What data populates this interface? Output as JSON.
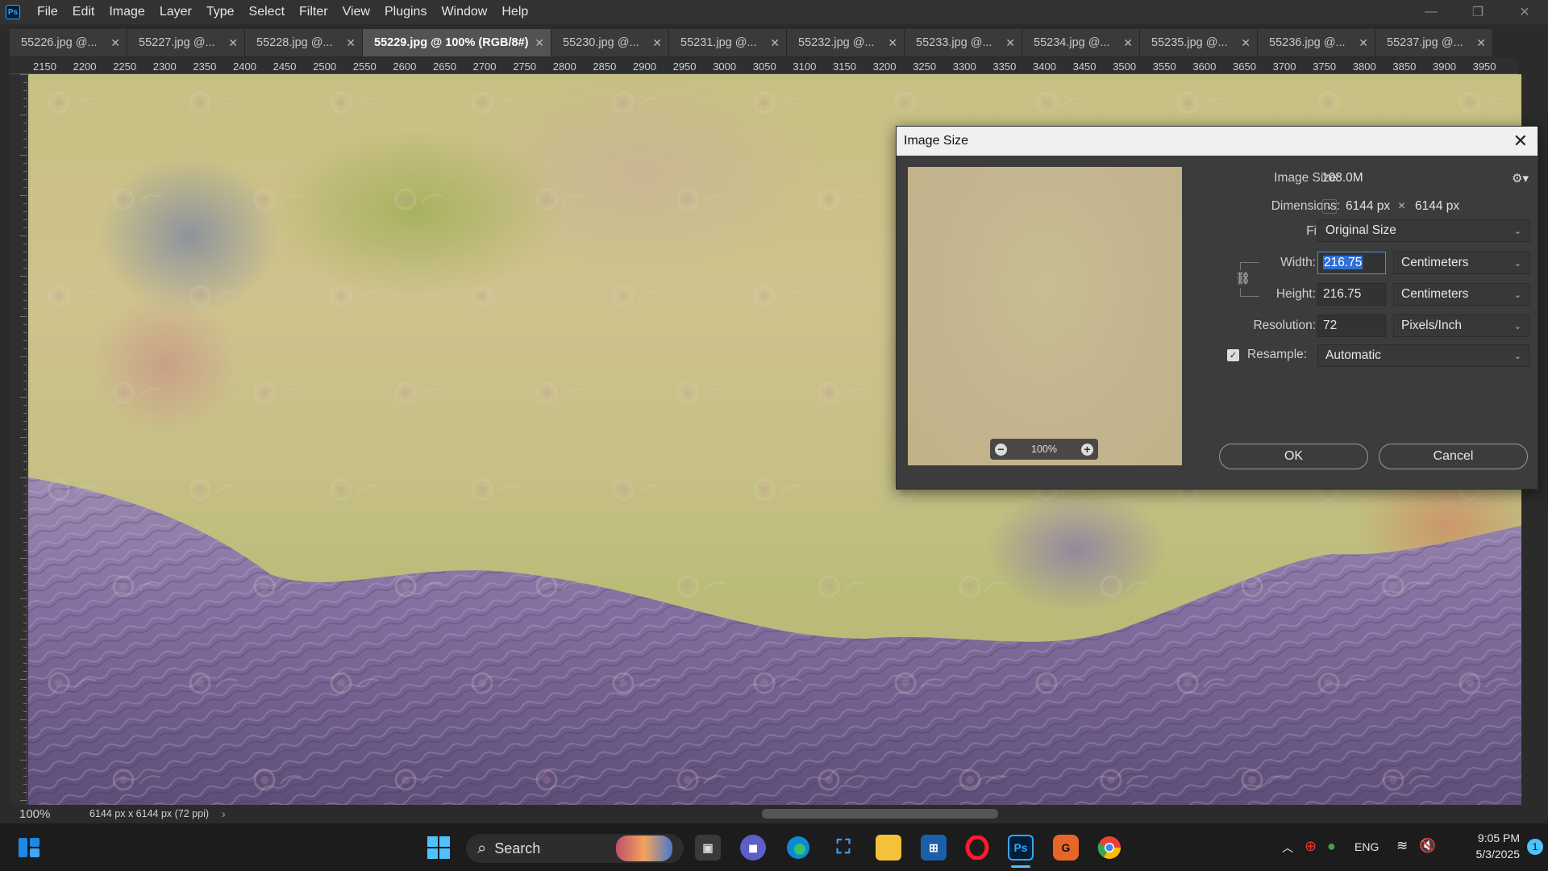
{
  "menubar": {
    "app_icon": "Ps",
    "items": [
      "File",
      "Edit",
      "Image",
      "Layer",
      "Type",
      "Select",
      "Filter",
      "View",
      "Plugins",
      "Window",
      "Help"
    ]
  },
  "tabs": [
    {
      "label": "55226.jpg @...",
      "active": false
    },
    {
      "label": "55227.jpg @...",
      "active": false
    },
    {
      "label": "55228.jpg @...",
      "active": false
    },
    {
      "label": "55229.jpg @ 100% (RGB/8#)",
      "active": true
    },
    {
      "label": "55230.jpg @...",
      "active": false
    },
    {
      "label": "55231.jpg @...",
      "active": false
    },
    {
      "label": "55232.jpg @...",
      "active": false
    },
    {
      "label": "55233.jpg @...",
      "active": false
    },
    {
      "label": "55234.jpg @...",
      "active": false
    },
    {
      "label": "55235.jpg @...",
      "active": false
    },
    {
      "label": "55236.jpg @...",
      "active": false
    },
    {
      "label": "55237.jpg @...",
      "active": false
    }
  ],
  "ruler": {
    "h_ticks": [
      "2150",
      "2200",
      "2250",
      "2300",
      "2350",
      "2400",
      "2450",
      "2500",
      "2550",
      "2600",
      "2650",
      "2700",
      "2750",
      "2800",
      "2850",
      "2900",
      "2950",
      "3000",
      "3050",
      "3100",
      "3150",
      "3200",
      "3250",
      "3300",
      "3350",
      "3400",
      "3450",
      "3500",
      "3550",
      "3600",
      "3650",
      "3700",
      "3750",
      "3800",
      "3850",
      "3900",
      "3950"
    ]
  },
  "status": {
    "zoom": "100%",
    "doc_info": "6144 px x 6144 px (72 ppi)",
    "arrow": "›"
  },
  "dialog": {
    "title": "Image Size",
    "image_size_label": "Image Size:",
    "image_size_value": "108.0M",
    "dimensions_label": "Dimensions:",
    "dim_w": "6144 px",
    "dim_x": "×",
    "dim_h": "6144 px",
    "fit_label": "Fit T...",
    "fit_value": "Original Size",
    "width_label": "Width:",
    "width_value": "216.75",
    "width_unit": "Centimeters",
    "height_label": "Height:",
    "height_value": "216.75",
    "height_unit": "Centimeters",
    "resolution_label": "Resolution:",
    "resolution_value": "72",
    "resolution_unit": "Pixels/Inch",
    "resample_label": "Resample:",
    "resample_checked": true,
    "resample_value": "Automatic",
    "preview_zoom": "100%",
    "ok": "OK",
    "cancel": "Cancel"
  },
  "taskbar": {
    "search_label": "Search",
    "language": "ENG",
    "time": "9:05 PM",
    "date": "5/3/2025",
    "notification_count": "1",
    "ps_icon": "Ps"
  },
  "colors": {
    "accent": "#2f6fd6",
    "ps_blue": "#31a8ff"
  }
}
